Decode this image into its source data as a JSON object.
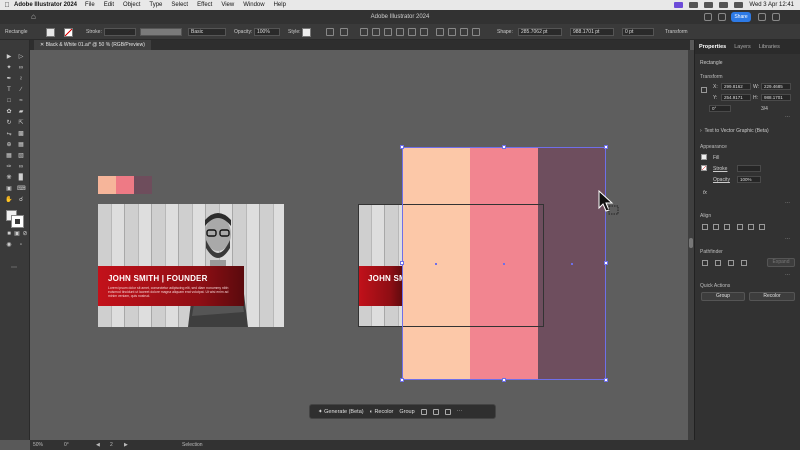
{
  "menubar": {
    "app_name": "Adobe Illustrator 2024",
    "items": [
      "File",
      "Edit",
      "Object",
      "Type",
      "Select",
      "Effect",
      "View",
      "Window",
      "Help"
    ],
    "clock": "Wed 3 Apr  12:41"
  },
  "titlebar": {
    "title": "Adobe Illustrator 2024",
    "share_label": "Share"
  },
  "control_bar": {
    "object_type": "Rectangle",
    "stroke_label": "Stroke:",
    "brush_label": "Basic",
    "opacity_label": "Opacity:",
    "opacity_value": "100%",
    "style_label": "Style:",
    "shape_label": "Shape:",
    "width_value": "285.7062 pt",
    "height_value": "988.1701 pt",
    "corner_value": "0 pt",
    "transform_label": "Transform"
  },
  "document_tab": {
    "label": "Black & White 01.ai* @ 50 % (RGB/Preview)"
  },
  "canvas": {
    "chip_colors": [
      "#f6b59a",
      "#ee7a85",
      "#6e4d5c"
    ],
    "stripe_colors": [
      "#fcc8a8",
      "#f28590",
      "#6e4e5e"
    ],
    "banner_left": {
      "name": "JOHN SMITH | FOUNDER",
      "body": "Lorem ipsum dolor sit amet, consectetur adipiscing elit, sed diam nonummy nibh euismod tincidunt ut laoreet dolore magna aliquam erat volutpat. Ut wisi enim ad minim veniam, quis nostrud."
    },
    "banner_right": {
      "name": "JOHN SMITH"
    }
  },
  "context_bar": {
    "generate_label": "Generate (Beta)",
    "recolor_label": "Recolor",
    "group_label": "Group"
  },
  "panel": {
    "tabs": [
      "Properties",
      "Layers",
      "Libraries"
    ],
    "object_type": "Rectangle",
    "transform_heading": "Transform",
    "x_label": "X:",
    "x_value": "299.8162",
    "y_label": "Y:",
    "y_value": "254.9171",
    "w_label": "W:",
    "w_value": "229.4685",
    "h_label": "H:",
    "h_value": "988.1701",
    "angle_value": "0°",
    "ratio_value": "3/4",
    "text_to_vector": "Text to Vector Graphic (Beta)",
    "appearance_heading": "Appearance",
    "fill_label": "Fill",
    "stroke_label": "Stroke",
    "opacity_label": "Opacity",
    "opacity_value": "100%",
    "fx_label": "fx",
    "align_heading": "Align",
    "pathfinder_heading": "Pathfinder",
    "expand_label": "Expand",
    "quick_actions_heading": "Quick Actions",
    "group_button": "Group",
    "recolor_button": "Recolor"
  },
  "status_bar": {
    "zoom": "50%",
    "rotation": "0°",
    "artboard": "2",
    "tool": "Selection"
  }
}
